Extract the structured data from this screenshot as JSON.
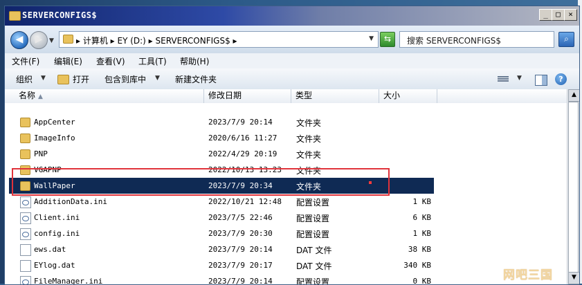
{
  "window": {
    "title": "SERVERCONFIGS$"
  },
  "titlebar_buttons": {
    "minimize": "_",
    "maximize": "□",
    "close": "×"
  },
  "address": {
    "crumbs": "▸ 计算机 ▸ EY (D:) ▸ SERVERCONFIGS$ ▸"
  },
  "search": {
    "placeholder": "搜索 SERVERCONFIGS$"
  },
  "menu": {
    "file": "文件(F)",
    "edit": "编辑(E)",
    "view": "查看(V)",
    "tools": "工具(T)",
    "help": "帮助(H)"
  },
  "toolbar": {
    "organize": "组织",
    "open": "打开",
    "include": "包含到库中",
    "new_folder": "新建文件夹"
  },
  "columns": {
    "name": "名称",
    "date": "修改日期",
    "type": "类型",
    "size": "大小"
  },
  "files": [
    {
      "name": "AppCenter",
      "date": "2023/7/9 20:14",
      "type": "文件夹",
      "size": "",
      "icon": "folder-icon"
    },
    {
      "name": "ImageInfo",
      "date": "2020/6/16 11:27",
      "type": "文件夹",
      "size": "",
      "icon": "folder-icon"
    },
    {
      "name": "PNP",
      "date": "2022/4/29 20:19",
      "type": "文件夹",
      "size": "",
      "icon": "folder-icon"
    },
    {
      "name": "VGAPNP",
      "date": "2022/10/13 13:23",
      "type": "文件夹",
      "size": "",
      "icon": "folder-icon"
    },
    {
      "name": "WallPaper",
      "date": "2023/7/9 20:34",
      "type": "文件夹",
      "size": "",
      "icon": "folder-icon",
      "selected": true
    },
    {
      "name": "AdditionData.ini",
      "date": "2022/10/21 12:48",
      "type": "配置设置",
      "size": "1 KB",
      "icon": "ini-file-icon"
    },
    {
      "name": "Client.ini",
      "date": "2023/7/5 22:46",
      "type": "配置设置",
      "size": "6 KB",
      "icon": "ini-file-icon"
    },
    {
      "name": "config.ini",
      "date": "2023/7/9 20:30",
      "type": "配置设置",
      "size": "1 KB",
      "icon": "ini-file-icon"
    },
    {
      "name": "ews.dat",
      "date": "2023/7/9 20:14",
      "type": "DAT 文件",
      "size": "38 KB",
      "icon": "dat-file-icon"
    },
    {
      "name": "EYlog.dat",
      "date": "2023/7/9 20:17",
      "type": "DAT 文件",
      "size": "340 KB",
      "icon": "dat-file-icon"
    },
    {
      "name": "FileManager.ini",
      "date": "2023/7/9 20:14",
      "type": "配置设置",
      "size": "0 KB",
      "icon": "ini-file-icon"
    }
  ],
  "watermark": "网吧三国",
  "colors": {
    "selection": "#0f2a54",
    "highlight_border": "#e0323a",
    "titlebar": "#10246b"
  }
}
